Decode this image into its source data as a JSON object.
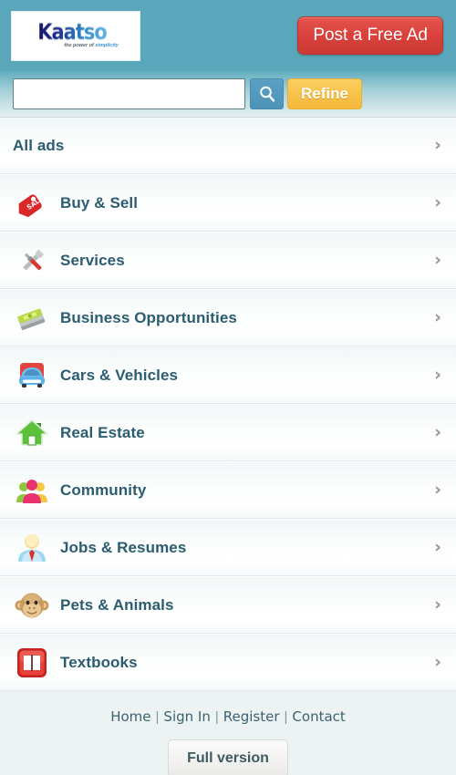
{
  "header": {
    "logo_wordmark": "Kaatso",
    "logo_tagline_prefix": "the power of ",
    "logo_tagline_accent": "simplicity",
    "post_ad_label": "Post a Free Ad",
    "bg_color": "#5aa7bb",
    "post_ad_color": "#d9413c"
  },
  "search": {
    "value": "",
    "placeholder": "",
    "search_icon": "magnifier-icon",
    "refine_label": "Refine",
    "refine_color": "#f8c34b"
  },
  "categories": [
    {
      "label": "All ads",
      "icon": "none",
      "chevron": "›"
    },
    {
      "label": "Buy & Sell",
      "icon": "sale-tag-icon",
      "chevron": "›"
    },
    {
      "label": "Services",
      "icon": "wrench-screwdriver-icon",
      "chevron": "›"
    },
    {
      "label": "Business Opportunities",
      "icon": "money-stack-icon",
      "chevron": "›"
    },
    {
      "label": "Cars & Vehicles",
      "icon": "car-icon",
      "chevron": "›"
    },
    {
      "label": "Real Estate",
      "icon": "house-icon",
      "chevron": "›"
    },
    {
      "label": "Community",
      "icon": "people-group-icon",
      "chevron": "›"
    },
    {
      "label": "Jobs & Resumes",
      "icon": "person-tie-icon",
      "chevron": "›"
    },
    {
      "label": "Pets & Animals",
      "icon": "monkey-face-icon",
      "chevron": "›"
    },
    {
      "label": "Textbooks",
      "icon": "open-book-icon",
      "chevron": "›"
    }
  ],
  "footer": {
    "links": [
      "Home",
      "Sign In",
      "Register",
      "Contact"
    ],
    "separator": "|",
    "full_version_label": "Full version"
  }
}
